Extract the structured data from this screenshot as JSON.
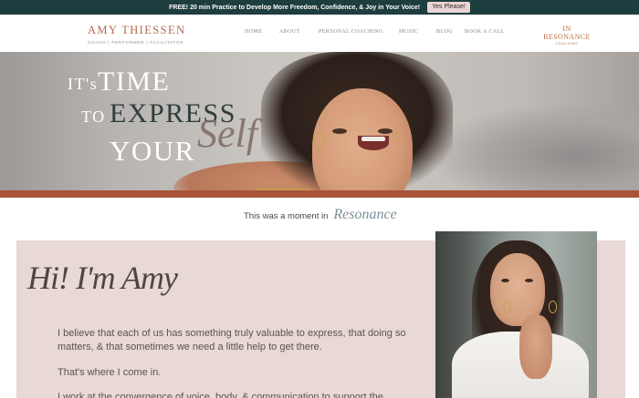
{
  "announcement": {
    "text": "FREE! 20 min Practice to Develop More Freedom, Confidence, & Joy in Your Voice!",
    "button_label": "Yes Please!"
  },
  "header": {
    "logo_name": "AMY THIESSEN",
    "logo_tagline": "COACH | PERFORMER | FACILITATOR",
    "nav": [
      "HOME",
      "ABOUT",
      "PERSONAL COACHING",
      "MUSIC",
      "BLOG",
      "BOOK A CALL"
    ],
    "brand2_name": "IN RESONANCE",
    "brand2_sub": "COACHING"
  },
  "hero": {
    "line1_small": "IT's",
    "line1_big": "TIME",
    "line2_small": "TO",
    "line2_big": "EXPRESS",
    "line3": "YOUR",
    "script": "Self"
  },
  "tagline": {
    "text": "This was a moment in",
    "script": "Resonance"
  },
  "about": {
    "script_heading": "Hi! I'm Amy",
    "paragraphs": [
      "I believe that each of us has something truly valuable to express, that doing so matters, & that sometimes we need a little help to get there.",
      "That's where I come in.",
      "I work at the convergence of voice, body, & communication to support the"
    ]
  },
  "colors": {
    "announcement_bg": "#1e3d3f",
    "brand_accent": "#b26a4d",
    "band": "#a8533a",
    "about_bg": "#e8d8d6"
  }
}
